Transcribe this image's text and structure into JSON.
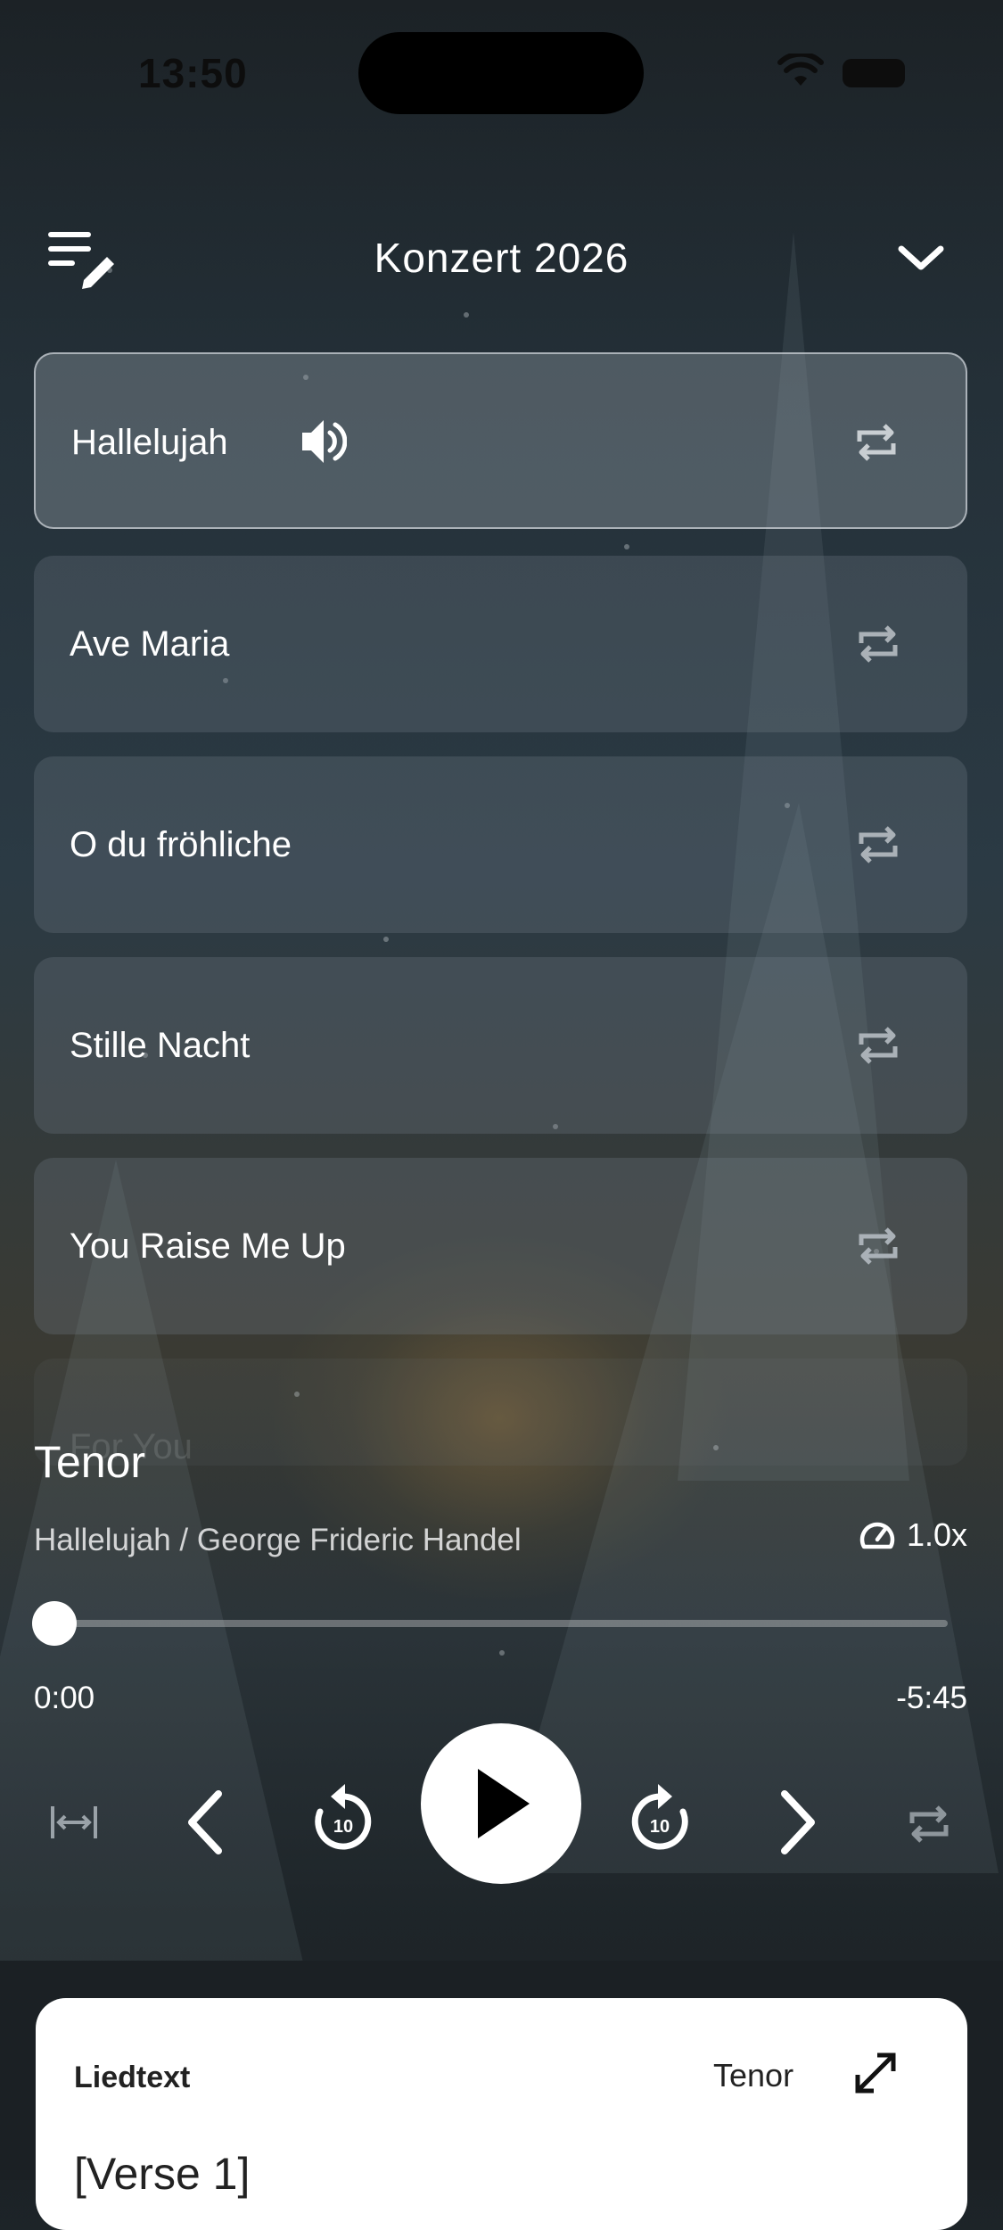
{
  "status_bar": {
    "time": "13:50"
  },
  "header": {
    "title": "Konzert 2026"
  },
  "playlist": {
    "items": [
      {
        "title": "Hallelujah",
        "playing": true
      },
      {
        "title": "Ave Maria",
        "playing": false
      },
      {
        "title": "O du fröhliche",
        "playing": false
      },
      {
        "title": "Stille Nacht",
        "playing": false
      },
      {
        "title": "You Raise Me Up",
        "playing": false
      },
      {
        "title": "For You",
        "playing": false
      }
    ]
  },
  "player": {
    "voice": "Tenor",
    "song_info": "Hallelujah / George Frideric Handel",
    "speed": "1.0x",
    "elapsed": "0:00",
    "remaining": "-5:45",
    "progress": 0,
    "skip_back_seconds": "10",
    "skip_forward_seconds": "10"
  },
  "lyrics": {
    "heading": "Liedtext",
    "voice": "Tenor",
    "first_line": "[Verse 1]"
  },
  "icons": {
    "edit_playlist": "playlist-edit-icon",
    "collapse": "chevron-down-icon",
    "speaker": "speaker-icon",
    "repeat": "repeat-icon",
    "speed": "speedometer-icon",
    "fit": "fit-width-icon",
    "previous": "chevron-left-icon",
    "rewind": "rewind-10-icon",
    "play": "play-icon",
    "forward": "forward-10-icon",
    "next": "chevron-right-icon",
    "expand": "expand-icon"
  }
}
